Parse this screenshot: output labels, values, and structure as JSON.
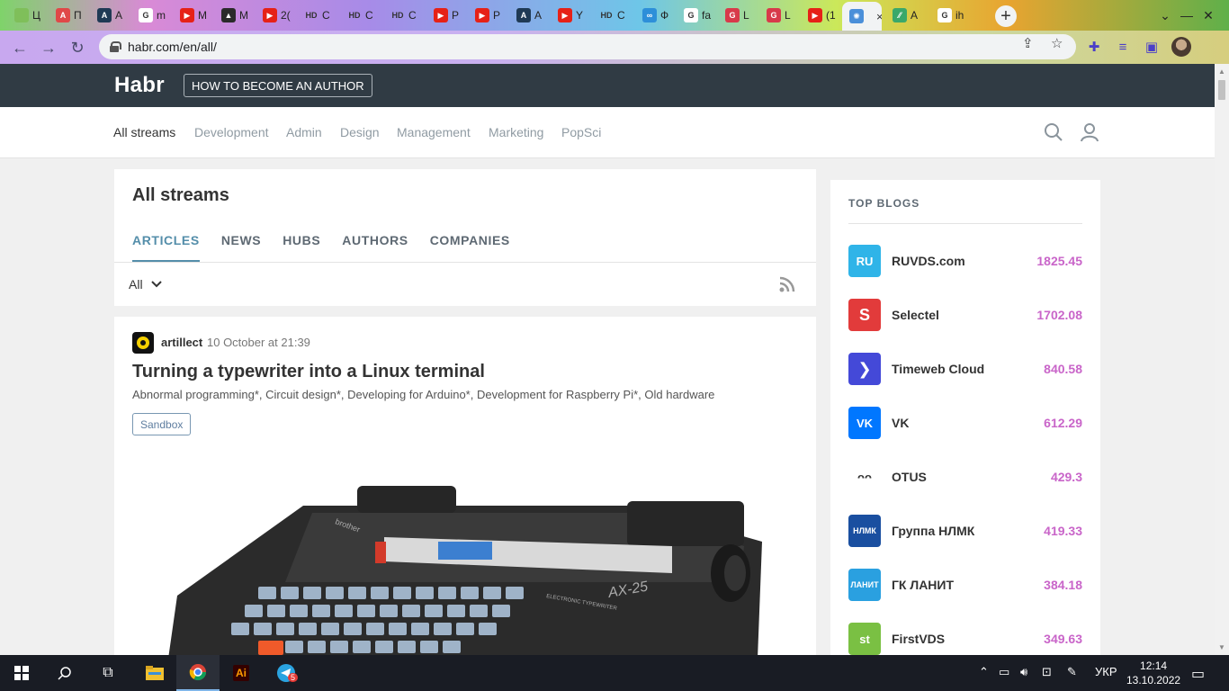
{
  "browser": {
    "tabs": [
      {
        "label": "Ц",
        "fav_color": "#7fbf5a",
        "fav_text": ""
      },
      {
        "label": "П",
        "fav_color": "#e04848",
        "fav_text": "A"
      },
      {
        "label": "A",
        "fav_color": "#1f3a55",
        "fav_text": "A"
      },
      {
        "label": "m",
        "fav_color": "#ffffff",
        "fav_text": "G"
      },
      {
        "label": "M",
        "fav_color": "#e62117",
        "fav_text": "▶"
      },
      {
        "label": "M",
        "fav_color": "#2a2a2a",
        "fav_text": "▲"
      },
      {
        "label": "2(",
        "fav_color": "#e62117",
        "fav_text": "▶"
      },
      {
        "label": "C",
        "fav_color": "transparent",
        "fav_text": "HD"
      },
      {
        "label": "C",
        "fav_color": "transparent",
        "fav_text": "HD"
      },
      {
        "label": "C",
        "fav_color": "transparent",
        "fav_text": "HD"
      },
      {
        "label": "P",
        "fav_color": "#e62117",
        "fav_text": "▶"
      },
      {
        "label": "P",
        "fav_color": "#e62117",
        "fav_text": "▶"
      },
      {
        "label": "A",
        "fav_color": "#1f3a55",
        "fav_text": "A"
      },
      {
        "label": "Y",
        "fav_color": "#e62117",
        "fav_text": "▶"
      },
      {
        "label": "C",
        "fav_color": "transparent",
        "fav_text": "HD"
      },
      {
        "label": "Ф",
        "fav_color": "#2d8fd9",
        "fav_text": "∞"
      },
      {
        "label": "fa",
        "fav_color": "#ffffff",
        "fav_text": "G"
      },
      {
        "label": "L",
        "fav_color": "#d83a4a",
        "fav_text": "G"
      },
      {
        "label": "L",
        "fav_color": "#d83a4a",
        "fav_text": "G"
      },
      {
        "label": "(1",
        "fav_color": "#e62117",
        "fav_text": "▶"
      },
      {
        "label": "",
        "fav_color": "#4a8fd9",
        "fav_text": "✺"
      },
      {
        "label": "A",
        "fav_color": "#3aa86a",
        "fav_text": "⁄⁄"
      },
      {
        "label": "ih",
        "fav_color": "#ffffff",
        "fav_text": "G"
      }
    ],
    "active_tab_close": "×",
    "new_tab": "+",
    "url": "habr.com/en/all/"
  },
  "habr": {
    "logo": "Habr",
    "become_author": "HOW TO BECOME AN AUTHOR",
    "menu": [
      "All streams",
      "Development",
      "Admin",
      "Design",
      "Management",
      "Marketing",
      "PopSci"
    ]
  },
  "streams": {
    "title": "All streams",
    "tabs": [
      "ARTICLES",
      "NEWS",
      "HUBS",
      "AUTHORS",
      "COMPANIES"
    ],
    "filter": "All"
  },
  "article": {
    "author": "artillect",
    "time": "10 October at 21:39",
    "title": "Turning a typewriter into a Linux terminal",
    "hubs": "Abnormal programming*, Circuit design*, Developing for Arduino*, Development for Raspberry Pi*, Old hardware",
    "badge": "Sandbox",
    "image_brand": "brother",
    "image_model": "AX-25",
    "image_caption": "ELECTRONIC TYPEWRITER"
  },
  "top_blogs": {
    "title": "TOP BLOGS",
    "items": [
      {
        "name": "RUVDS.com",
        "score": "1825.45",
        "logo_color": "#2fb4e8",
        "logo_text": "RU"
      },
      {
        "name": "Selectel",
        "score": "1702.08",
        "logo_color": "#e23b3b",
        "logo_text": "S"
      },
      {
        "name": "Timeweb Cloud",
        "score": "840.58",
        "logo_color": "#4449d8",
        "logo_text": "❯"
      },
      {
        "name": "VK",
        "score": "612.29",
        "logo_color": "#0077ff",
        "logo_text": "VK"
      },
      {
        "name": "OTUS",
        "score": "429.3",
        "logo_color": "#ffffff",
        "logo_text": "ᴖᴖ"
      },
      {
        "name": "Группа НЛМК",
        "score": "419.33",
        "logo_color": "#1a4fa0",
        "logo_text": "НЛМК"
      },
      {
        "name": "ГК ЛАНИТ",
        "score": "384.18",
        "logo_color": "#2aa0e0",
        "logo_text": "ЛАНИТ"
      },
      {
        "name": "FirstVDS",
        "score": "349.63",
        "logo_color": "#7ac043",
        "logo_text": "st"
      }
    ]
  },
  "taskbar": {
    "lang": "УКР",
    "time": "12:14",
    "date": "13.10.2022",
    "telegram_badge": "5",
    "ai_label": "Ai"
  }
}
